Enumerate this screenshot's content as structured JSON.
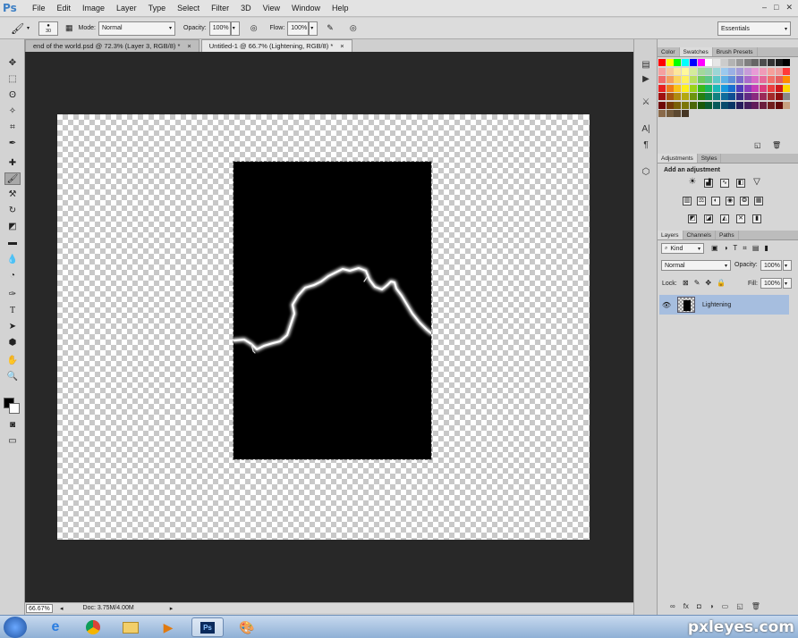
{
  "menu": {
    "logo": "Ps",
    "items": [
      "File",
      "Edit",
      "Image",
      "Layer",
      "Type",
      "Select",
      "Filter",
      "3D",
      "View",
      "Window",
      "Help"
    ]
  },
  "options": {
    "brush_size": "30",
    "mode_label": "Mode:",
    "mode_value": "Normal",
    "opacity_label": "Opacity:",
    "opacity_value": "100%",
    "flow_label": "Flow:",
    "flow_value": "100%",
    "workspace": "Essentials"
  },
  "tabs": [
    {
      "label": "end of the world.psd @ 72.3% (Layer 3, RGB/8) *",
      "close": "×"
    },
    {
      "label": "Untitled-1 @ 66.7% (Lightening, RGB/8) *",
      "close": "×"
    }
  ],
  "status": {
    "zoom": "66.67%",
    "doc": "Doc: 3.75M/4.00M"
  },
  "swatch_panel": {
    "tabs": [
      "Color",
      "Swatches",
      "Brush Presets"
    ]
  },
  "adjustments": {
    "tabs": [
      "Adjustments",
      "Styles"
    ],
    "title": "Add an adjustment"
  },
  "layers": {
    "tabs": [
      "Layers",
      "Channels",
      "Paths"
    ],
    "kind": "Kind",
    "blend": "Normal",
    "opacity_label": "Opacity:",
    "opacity_value": "100%",
    "lock_label": "Lock:",
    "fill_label": "Fill:",
    "fill_value": "100%",
    "layer_name": "Lightening"
  },
  "taskbar": {
    "watermark": "pxleyes.com"
  },
  "colors": {
    "foreground": "#000000",
    "background": "#ffffff",
    "layer_selected": "#a6bedf"
  }
}
